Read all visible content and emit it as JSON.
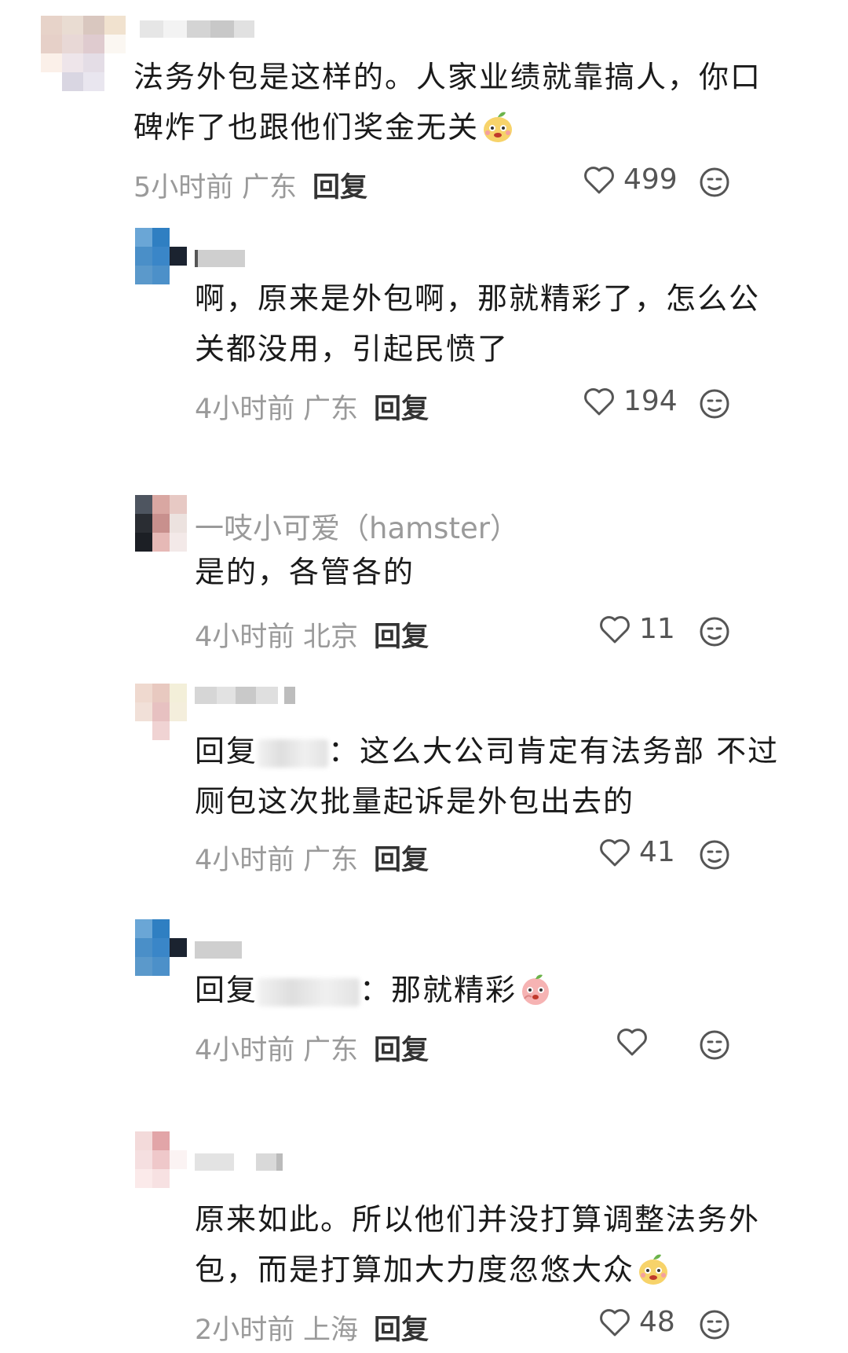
{
  "comments": [
    {
      "content_lines": [
        "法务外包是这样的。人家业绩就靠搞人，你口",
        "碑炸了也跟他们奖金无关"
      ],
      "time": "5小时前",
      "location": "广东",
      "reply_label": "回复",
      "likes": "499"
    },
    {
      "content_lines": [
        "啊，原来是外包啊，那就精彩了，怎么公",
        "关都没用，引起民愤了"
      ],
      "time": "4小时前",
      "location": "广东",
      "reply_label": "回复",
      "likes": "194"
    },
    {
      "username": "一吱小可爱（hamster）",
      "content_lines": [
        "是的，各管各的"
      ],
      "time": "4小时前",
      "location": "北京",
      "reply_label": "回复",
      "likes": "11"
    },
    {
      "content_prefix": "回复",
      "content_after_blur": "：这么大公司肯定有法务部 不过",
      "content_line2": "厕包这次批量起诉是外包出去的",
      "time": "4小时前",
      "location": "广东",
      "reply_label": "回复",
      "likes": "41"
    },
    {
      "content_prefix": "回复",
      "content_after_blur": "：那就精彩",
      "time": "4小时前",
      "location": "广东",
      "reply_label": "回复",
      "likes": ""
    },
    {
      "content_lines": [
        "原来如此。所以他们并没打算调整法务外",
        "包，而是打算加大力度忽悠大众"
      ],
      "time": "2小时前",
      "location": "上海",
      "reply_label": "回复",
      "likes": "48"
    }
  ],
  "icons": {
    "like": "heart-outline-icon",
    "dislike": "meh-face-icon",
    "emoji_pear": "pear-face-emoji",
    "emoji_peach": "peach-face-emoji"
  },
  "colors": {
    "text": "#1a1a1a",
    "meta": "#9a9a9a",
    "icon": "#555555"
  }
}
